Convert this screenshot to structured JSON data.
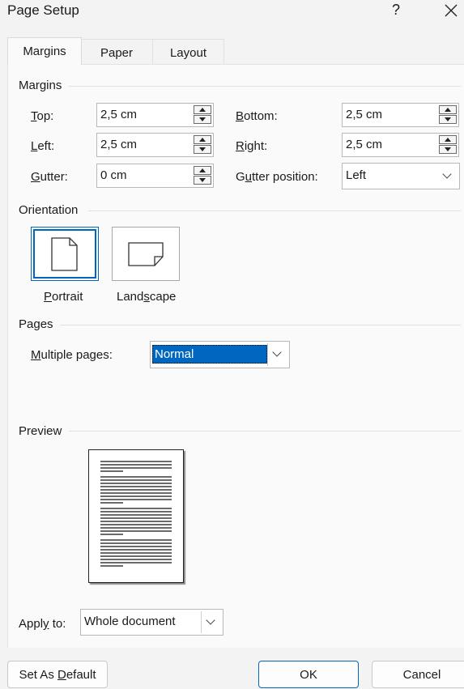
{
  "dialog": {
    "title": "Page Setup",
    "help": "?",
    "close_icon": "close-icon"
  },
  "tabs": [
    {
      "label": "Margins",
      "active": true
    },
    {
      "label": "Paper",
      "active": false
    },
    {
      "label": "Layout",
      "active": false
    }
  ],
  "margins": {
    "group_label": "Margins",
    "top": {
      "label_u": "T",
      "label_rest": "op:",
      "value": "2,5 cm"
    },
    "left": {
      "label_u": "L",
      "label_rest": "eft:",
      "value": "2,5 cm"
    },
    "gutter": {
      "label_u": "G",
      "label_rest": "utter:",
      "value": "0 cm"
    },
    "bottom": {
      "label_u": "B",
      "label_rest": "ottom:",
      "value": "2,5 cm"
    },
    "right": {
      "label_u": "R",
      "label_rest": "ight:",
      "value": "2,5 cm"
    },
    "gutter_position": {
      "label_pre": "G",
      "label_u": "u",
      "label_rest": "tter position:",
      "value": "Left"
    }
  },
  "orientation": {
    "group_label": "Orientation",
    "portrait": {
      "label_u": "P",
      "label_rest": "ortrait",
      "selected": true,
      "icon": "portrait-page-icon"
    },
    "landscape": {
      "label_pre": "Land",
      "label_u": "s",
      "label_rest": "cape",
      "selected": false,
      "icon": "landscape-page-icon"
    }
  },
  "pages": {
    "group_label": "Pages",
    "multiple_pages": {
      "label_u": "M",
      "label_rest": "ultiple pages:",
      "value": "Normal"
    }
  },
  "preview": {
    "group_label": "Preview"
  },
  "apply_to": {
    "label_pre": "Appl",
    "label_u": "y",
    "label_rest": " to:",
    "value": "Whole document"
  },
  "buttons": {
    "set_default": {
      "label_pre": "Set As ",
      "label_u": "D",
      "label_rest": "efault"
    },
    "ok": "OK",
    "cancel": "Cancel"
  },
  "colors": {
    "accent": "#0067c0",
    "selection": "#0067c0"
  }
}
